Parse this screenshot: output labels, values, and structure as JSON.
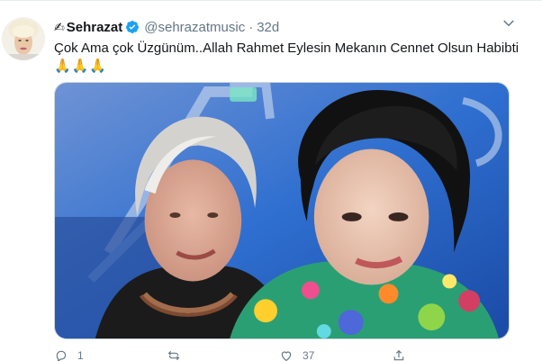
{
  "tweet": {
    "display_name": "Sehrazat",
    "handle": "@sehrazatmusic",
    "separator": "·",
    "time": "32d",
    "text": "Çok Ama çok Üzgünüm..Allah Rahmet Eylesin Mekanın Cennet Olsun Habibti",
    "emoji": "🙏🙏🙏",
    "image_alt": "Two older women in a selfie against a blue background",
    "actions": {
      "reply_count": "1",
      "retweet_count": "",
      "like_count": "37"
    }
  },
  "colors": {
    "text": "#14171a",
    "muted": "#657786",
    "verified": "#1da1f2",
    "border": "#e6ecf0"
  },
  "icons": [
    "quill-icon",
    "verified-badge-icon",
    "chevron-down-icon",
    "reply-icon",
    "retweet-icon",
    "like-icon",
    "share-icon"
  ]
}
